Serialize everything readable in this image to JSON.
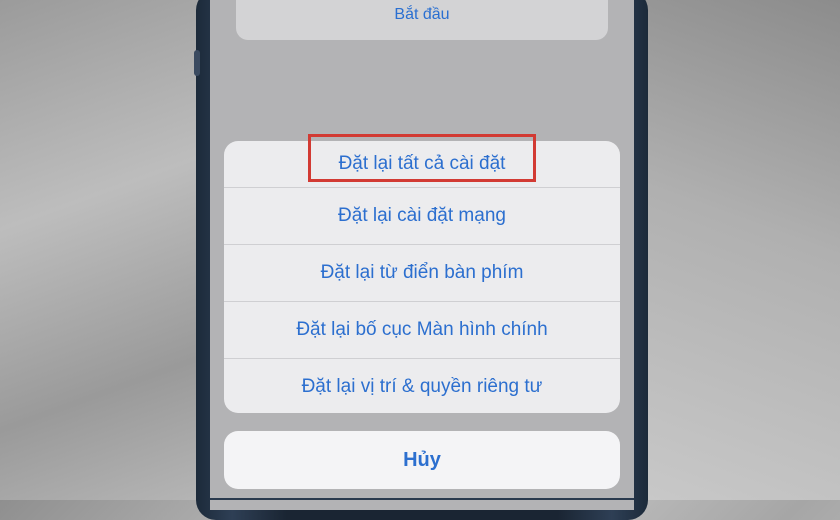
{
  "top_card": {
    "label": "Bắt đầu"
  },
  "action_sheet": {
    "items": [
      {
        "label": "Đặt lại tất cả cài đặt",
        "highlighted": true
      },
      {
        "label": "Đặt lại cài đặt mạng"
      },
      {
        "label": "Đặt lại từ điển bàn phím"
      },
      {
        "label": "Đặt lại bố cục Màn hình chính"
      },
      {
        "label": "Đặt lại vị trí & quyền riêng tư"
      }
    ]
  },
  "cancel_label": "Hủy",
  "colors": {
    "accent": "#2c6fcf",
    "highlight_border": "#d23a33",
    "sheet_bg": "#ececee",
    "screen_dim": "#b3b3b5",
    "frame": "#1a2533"
  }
}
